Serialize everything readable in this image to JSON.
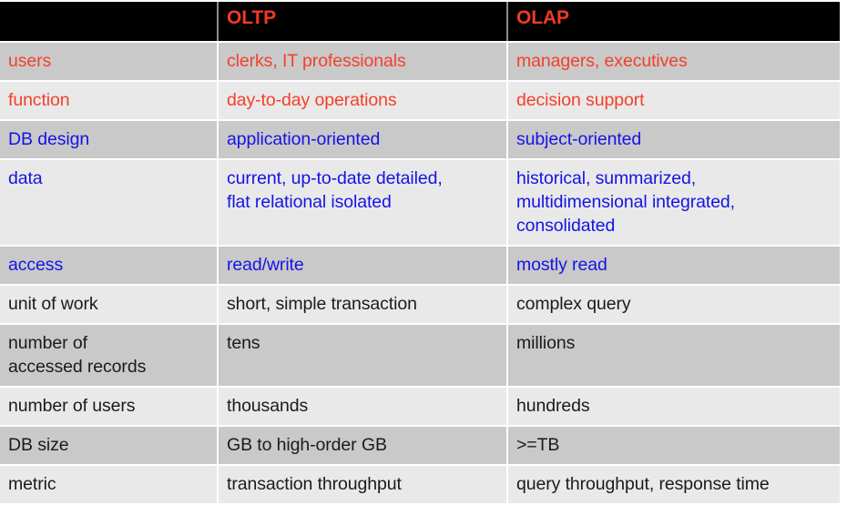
{
  "table": {
    "columns": [
      {
        "label": "",
        "name": "row-label-column"
      },
      {
        "label": "OLTP",
        "name": "oltp-column"
      },
      {
        "label": "OLAP",
        "name": "olap-column"
      }
    ],
    "colors": {
      "header_background": "#000000",
      "header_text": "#ef3b24",
      "red_text": "#f4402b",
      "blue_text": "#1414e6",
      "black_text": "#1b1b1b",
      "row_shade_dark": "#c9c9c9",
      "row_shade_light": "#e9e9e9",
      "grid_line": "#ffffff"
    },
    "rows": [
      {
        "label": "users",
        "oltp": "clerks, IT professionals",
        "olap": "managers, executives",
        "text_color": "red",
        "shade": "dark"
      },
      {
        "label": "function",
        "oltp": "day-to-day operations",
        "olap": "decision support",
        "text_color": "red",
        "shade": "light"
      },
      {
        "label": "DB design",
        "oltp": "application-oriented",
        "olap": "subject-oriented",
        "text_color": "blue",
        "shade": "dark"
      },
      {
        "label": "data",
        "oltp": "current, up-to-date detailed,\nflat relational isolated",
        "olap": "historical, summarized,\nmultidimensional integrated,\nconsolidated",
        "text_color": "blue",
        "shade": "light"
      },
      {
        "label": "access",
        "oltp": "read/write",
        "olap": "mostly read",
        "text_color": "blue",
        "shade": "dark"
      },
      {
        "label": "unit of work",
        "oltp": "short, simple transaction",
        "olap": "complex query",
        "text_color": "black",
        "shade": "light"
      },
      {
        "label": "number of\naccessed records",
        "oltp": "tens",
        "olap": "millions",
        "text_color": "black",
        "shade": "dark"
      },
      {
        "label": "number of users",
        "oltp": "thousands",
        "olap": "hundreds",
        "text_color": "black",
        "shade": "light"
      },
      {
        "label": "DB size",
        "oltp": "GB to high-order GB",
        "olap": ">=TB",
        "text_color": "black",
        "shade": "dark"
      },
      {
        "label": "metric",
        "oltp": "transaction throughput",
        "olap": "query throughput, response time",
        "text_color": "black",
        "shade": "light"
      }
    ]
  }
}
